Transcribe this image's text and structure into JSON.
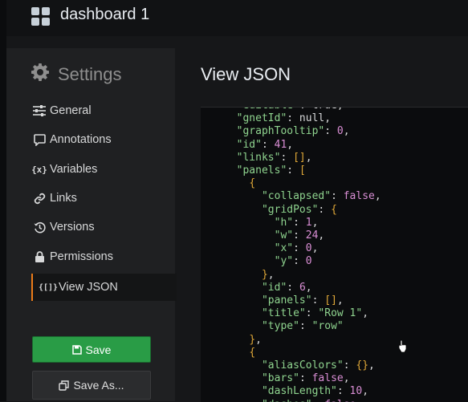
{
  "header": {
    "dashboard_title": "dashboard 1"
  },
  "sidebar": {
    "section_title": "Settings",
    "items": [
      {
        "label": "General",
        "icon": "sliders-icon"
      },
      {
        "label": "Annotations",
        "icon": "comment-icon"
      },
      {
        "label": "Variables",
        "icon": "variable-icon"
      },
      {
        "label": "Links",
        "icon": "link-icon"
      },
      {
        "label": "Versions",
        "icon": "history-icon"
      },
      {
        "label": "Permissions",
        "icon": "lock-icon"
      },
      {
        "label": "View JSON",
        "icon": "json-icon",
        "active": true
      }
    ],
    "save_label": "Save",
    "save_as_label": "Save As..."
  },
  "main": {
    "title": "View JSON",
    "json_lines": [
      [
        [
          "  ",
          ""
        ],
        [
          "\"editable\"",
          "k"
        ],
        [
          ": true,",
          ""
        ]
      ],
      [
        [
          "  ",
          ""
        ],
        [
          "\"gnetId\"",
          "k"
        ],
        [
          ": null,",
          ""
        ]
      ],
      [
        [
          "  ",
          ""
        ],
        [
          "\"graphTooltip\"",
          "k"
        ],
        [
          ": ",
          ""
        ],
        [
          "0",
          "n"
        ],
        [
          ",",
          ""
        ]
      ],
      [
        [
          "  ",
          ""
        ],
        [
          "\"id\"",
          "k"
        ],
        [
          ": ",
          ""
        ],
        [
          "41",
          "n"
        ],
        [
          ",",
          ""
        ]
      ],
      [
        [
          "  ",
          ""
        ],
        [
          "\"links\"",
          "k"
        ],
        [
          ": ",
          ""
        ],
        [
          "[]",
          "p"
        ],
        [
          ",",
          ""
        ]
      ],
      [
        [
          "  ",
          ""
        ],
        [
          "\"panels\"",
          "k"
        ],
        [
          ": ",
          ""
        ],
        [
          "[",
          "p"
        ]
      ],
      [
        [
          "    ",
          ""
        ],
        [
          "{",
          "p"
        ]
      ],
      [
        [
          "      ",
          ""
        ],
        [
          "\"collapsed\"",
          "k"
        ],
        [
          ": ",
          ""
        ],
        [
          "false",
          "n"
        ],
        [
          ",",
          ""
        ]
      ],
      [
        [
          "      ",
          ""
        ],
        [
          "\"gridPos\"",
          "k"
        ],
        [
          ": ",
          ""
        ],
        [
          "{",
          "p"
        ]
      ],
      [
        [
          "        ",
          ""
        ],
        [
          "\"h\"",
          "k"
        ],
        [
          ": ",
          ""
        ],
        [
          "1",
          "n"
        ],
        [
          ",",
          ""
        ]
      ],
      [
        [
          "        ",
          ""
        ],
        [
          "\"w\"",
          "k"
        ],
        [
          ": ",
          ""
        ],
        [
          "24",
          "n"
        ],
        [
          ",",
          ""
        ]
      ],
      [
        [
          "        ",
          ""
        ],
        [
          "\"x\"",
          "k"
        ],
        [
          ": ",
          ""
        ],
        [
          "0",
          "n"
        ],
        [
          ",",
          ""
        ]
      ],
      [
        [
          "        ",
          ""
        ],
        [
          "\"y\"",
          "k"
        ],
        [
          ": ",
          ""
        ],
        [
          "0",
          "n"
        ]
      ],
      [
        [
          "      ",
          ""
        ],
        [
          "}",
          "p"
        ],
        [
          ",",
          ""
        ]
      ],
      [
        [
          "      ",
          ""
        ],
        [
          "\"id\"",
          "k"
        ],
        [
          ": ",
          ""
        ],
        [
          "6",
          "n"
        ],
        [
          ",",
          ""
        ]
      ],
      [
        [
          "      ",
          ""
        ],
        [
          "\"panels\"",
          "k"
        ],
        [
          ": ",
          ""
        ],
        [
          "[]",
          "p"
        ],
        [
          ",",
          ""
        ]
      ],
      [
        [
          "      ",
          ""
        ],
        [
          "\"title\"",
          "k"
        ],
        [
          ": ",
          ""
        ],
        [
          "\"Row 1\"",
          "s"
        ],
        [
          ",",
          ""
        ]
      ],
      [
        [
          "      ",
          ""
        ],
        [
          "\"type\"",
          "k"
        ],
        [
          ": ",
          ""
        ],
        [
          "\"row\"",
          "s"
        ]
      ],
      [
        [
          "    ",
          ""
        ],
        [
          "}",
          "p"
        ],
        [
          ",",
          ""
        ]
      ],
      [
        [
          "    ",
          ""
        ],
        [
          "{",
          "p"
        ]
      ],
      [
        [
          "      ",
          ""
        ],
        [
          "\"aliasColors\"",
          "k"
        ],
        [
          ": ",
          ""
        ],
        [
          "{}",
          "p"
        ],
        [
          ",",
          ""
        ]
      ],
      [
        [
          "      ",
          ""
        ],
        [
          "\"bars\"",
          "k"
        ],
        [
          ": ",
          ""
        ],
        [
          "false",
          "n"
        ],
        [
          ",",
          ""
        ]
      ],
      [
        [
          "      ",
          ""
        ],
        [
          "\"dashLength\"",
          "k"
        ],
        [
          ": ",
          ""
        ],
        [
          "10",
          "n"
        ],
        [
          ",",
          ""
        ]
      ],
      [
        [
          "      ",
          ""
        ],
        [
          "\"dashes\"",
          "k"
        ],
        [
          ": ",
          ""
        ],
        [
          "false",
          "n"
        ],
        [
          ",",
          ""
        ]
      ]
    ]
  }
}
